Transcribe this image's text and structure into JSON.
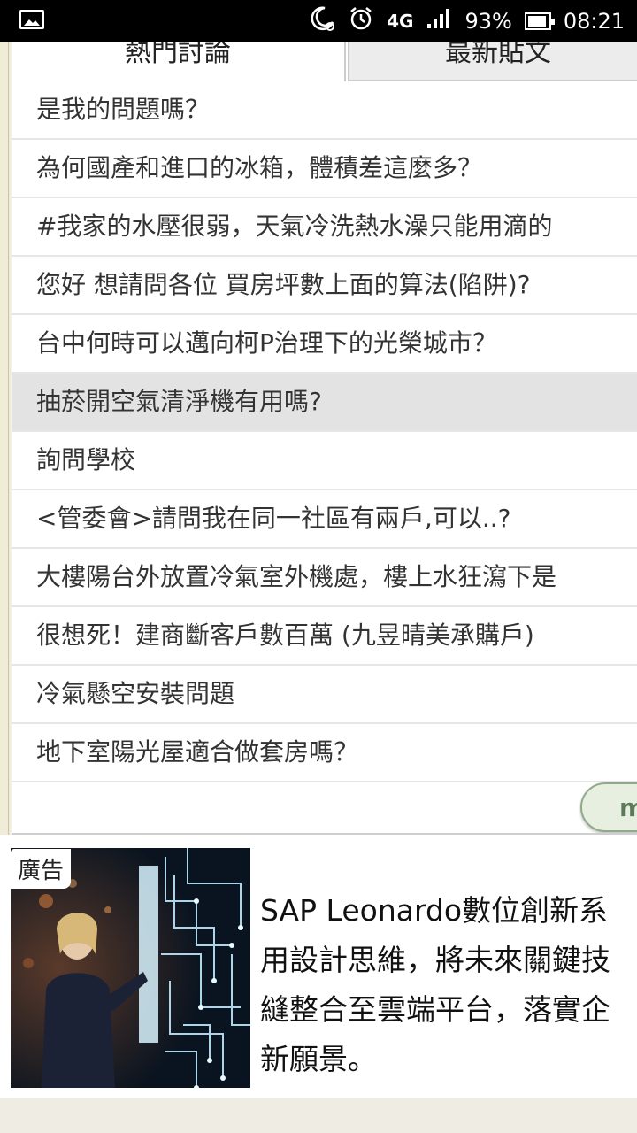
{
  "status_bar": {
    "signal_label": "4G",
    "battery_percent": "93%",
    "battery_level": 0.93,
    "time": "08:21"
  },
  "tabs": [
    {
      "label": "熱門討論"
    },
    {
      "label": "最新貼文"
    }
  ],
  "topics": [
    "是我的問題嗎？",
    "為何國產和進口的冰箱，體積差這麼多？",
    "#我家的水壓很弱，天氣冷洗熱水澡只能用滴的",
    "您好 想請問各位 買房坪數上面的算法(陷阱)?",
    "台中何時可以邁向柯P治理下的光榮城市？",
    "抽菸開空氣清淨機有用嗎?",
    "詢問學校",
    "<管委會>請問我在同一社區有兩戶,可以..?",
    "大樓陽台外放置冷氣室外機處，樓上水狂瀉下是",
    "很想死！建商斷客戶數百萬 (九昱晴美承購戶)",
    "冷氣懸空安裝問題",
    "地下室陽光屋適合做套房嗎？"
  ],
  "more_button": {
    "label": "m"
  },
  "ad": {
    "label": "廣告",
    "text": "SAP Leonardo數位創新系\n用設計思維，將未來關鍵技\n縫整合至雲端平台，落實企\n新願景。"
  },
  "colors": {
    "highlight_row": "#e3e3e3",
    "more_button_border": "#8fa98a",
    "status_bar_bg": "#000000"
  }
}
